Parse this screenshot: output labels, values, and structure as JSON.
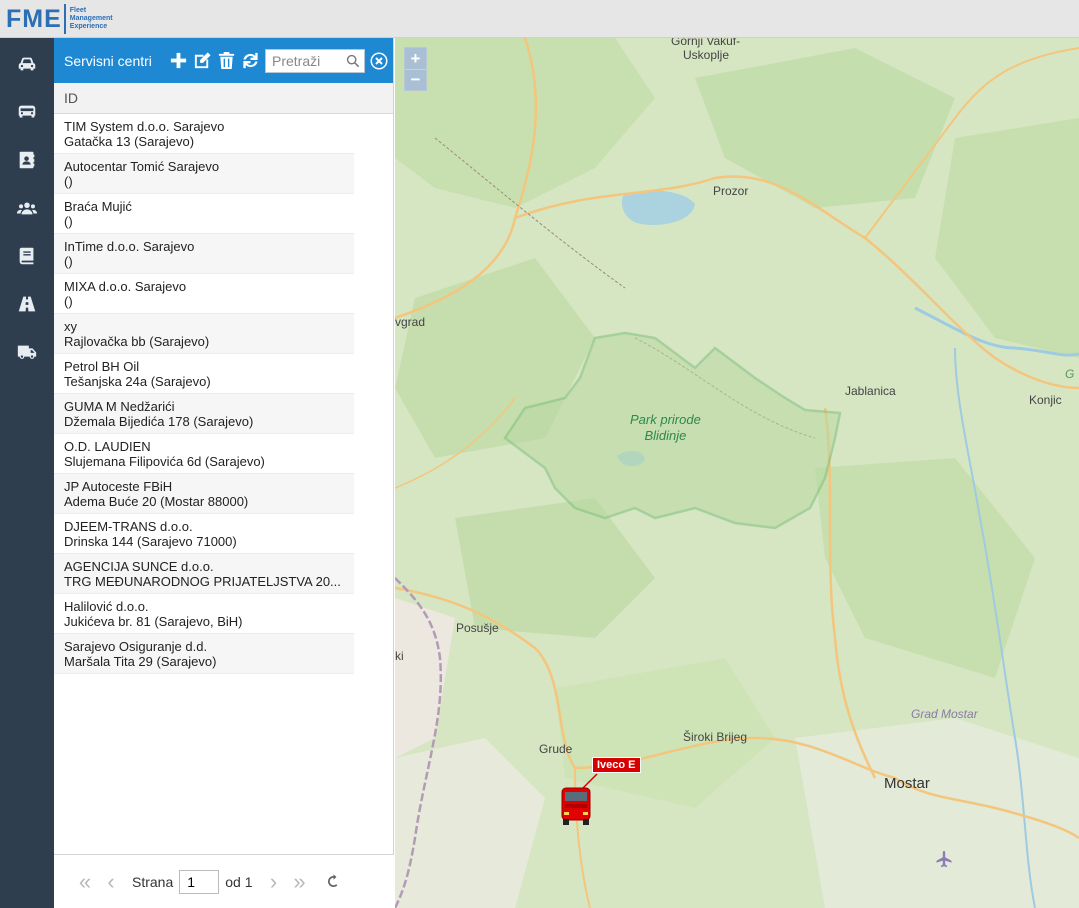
{
  "app": {
    "logo_letters": "FME",
    "logo_line1": "Fleet",
    "logo_line2": "Management",
    "logo_line3": "Experience"
  },
  "nav": [
    "car-icon",
    "bus-icon",
    "contacts-icon",
    "users-icon",
    "book-icon",
    "road-icon",
    "truck-icon"
  ],
  "panel": {
    "title": "Servisni centri",
    "search_placeholder": "Pretraži",
    "column_header": "ID",
    "rows": [
      {
        "name": "TIM System d.o.o. Sarajevo",
        "address": "Gatačka 13 (Sarajevo)"
      },
      {
        "name": "Autocentar Tomić Sarajevo",
        "address": "()"
      },
      {
        "name": "Braća Mujić",
        "address": "()"
      },
      {
        "name": "InTime d.o.o. Sarajevo",
        "address": "()"
      },
      {
        "name": "MIXA d.o.o. Sarajevo",
        "address": "()"
      },
      {
        "name": "xy",
        "address": "Rajlovačka bb (Sarajevo)"
      },
      {
        "name": "Petrol BH Oil",
        "address": "Tešanjska 24a (Sarajevo)"
      },
      {
        "name": "GUMA M Nedžarići",
        "address": "Džemala Bijedića 178 (Sarajevo)"
      },
      {
        "name": "O.D. LAUDIEN",
        "address": "Slujemana Filipovića 6d (Sarajevo)"
      },
      {
        "name": "JP Autoceste FBiH",
        "address": "Adema Buće 20 (Mostar 88000)"
      },
      {
        "name": "DJEEM-TRANS d.o.o.",
        "address": "Drinska 144 (Sarajevo 71000)"
      },
      {
        "name": "AGENCIJA SUNCE d.o.o.",
        "address": "TRG MEĐUNARODNOG PRIJATELJSTVA 20..."
      },
      {
        "name": "Halilović d.o.o.",
        "address": "Jukićeva br. 81 (Sarajevo, BiH)"
      },
      {
        "name": "Sarajevo Osiguranje d.d.",
        "address": "Maršala Tita 29 (Sarajevo)"
      }
    ],
    "pager": {
      "page_label": "Strana",
      "page_value": "1",
      "of_label": "od 1"
    }
  },
  "map": {
    "zoom_in": "+",
    "zoom_out": "−",
    "labels": {
      "gornji_vakuf": "Gornji Vakuf-",
      "uskoplje": "Uskoplje",
      "prozor": "Prozor",
      "vgrad": "vgrad",
      "jablanica": "Jablanica",
      "konjic": "Konjic",
      "posusje": "Posušje",
      "grude": "Grude",
      "siroki": "Široki Brijeg",
      "mostar": "Mostar",
      "grad_mostar": "Grad Mostar",
      "ki": "ki",
      "g_edge": "G"
    },
    "park_line1": "Park prirode",
    "park_line2": "Blidinje",
    "vehicle_label": "Iveco E"
  }
}
